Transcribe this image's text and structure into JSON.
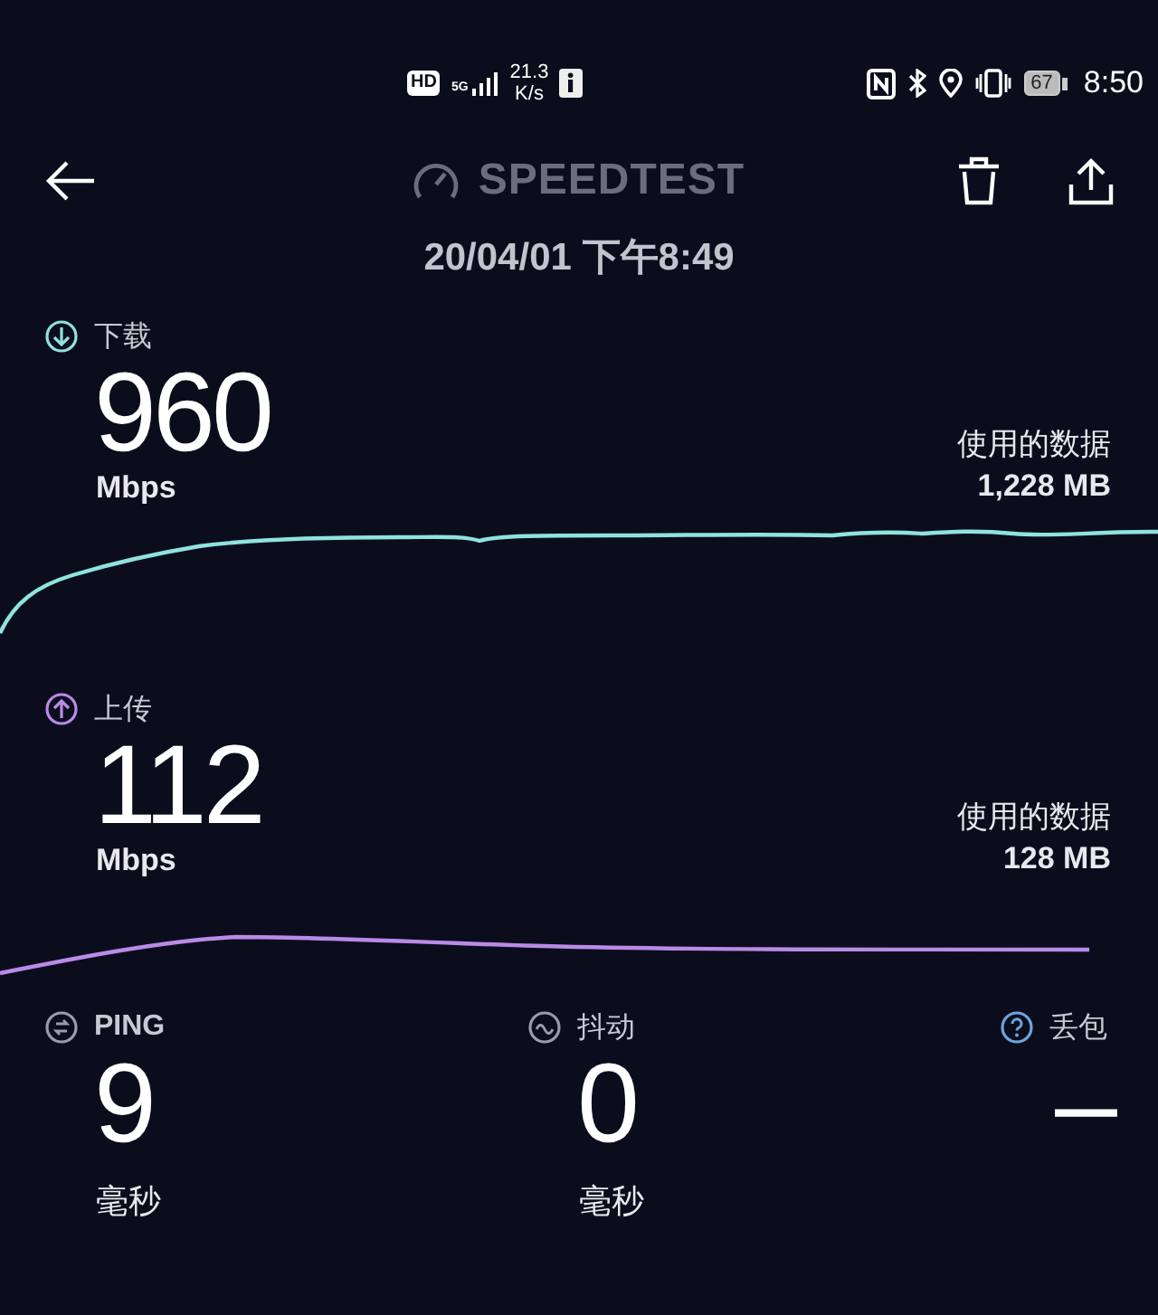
{
  "status_bar": {
    "hd_badge": "HD",
    "network_type": "5G",
    "network_speed": "21.3",
    "network_speed_unit": "K/s",
    "battery": "67",
    "time": "8:50"
  },
  "header": {
    "title": "SPEEDTEST",
    "date": "20/04/01 下午8:49"
  },
  "results": [
    {
      "kind": "download",
      "label": "下载",
      "value": "960",
      "unit": "Mbps",
      "data_label": "使用的数据",
      "data_value": "1,228 MB",
      "color": "#8fe3df"
    },
    {
      "kind": "upload",
      "label": "上传",
      "value": "112",
      "unit": "Mbps",
      "data_label": "使用的数据",
      "data_value": "128 MB",
      "color": "#b98be8"
    }
  ],
  "metrics": [
    {
      "kind": "ping",
      "label": "PING",
      "value": "9",
      "unit": "毫秒"
    },
    {
      "kind": "jitter",
      "label": "抖动",
      "value": "0",
      "unit": "毫秒"
    },
    {
      "kind": "loss",
      "label": "丢包",
      "value": "–"
    }
  ]
}
